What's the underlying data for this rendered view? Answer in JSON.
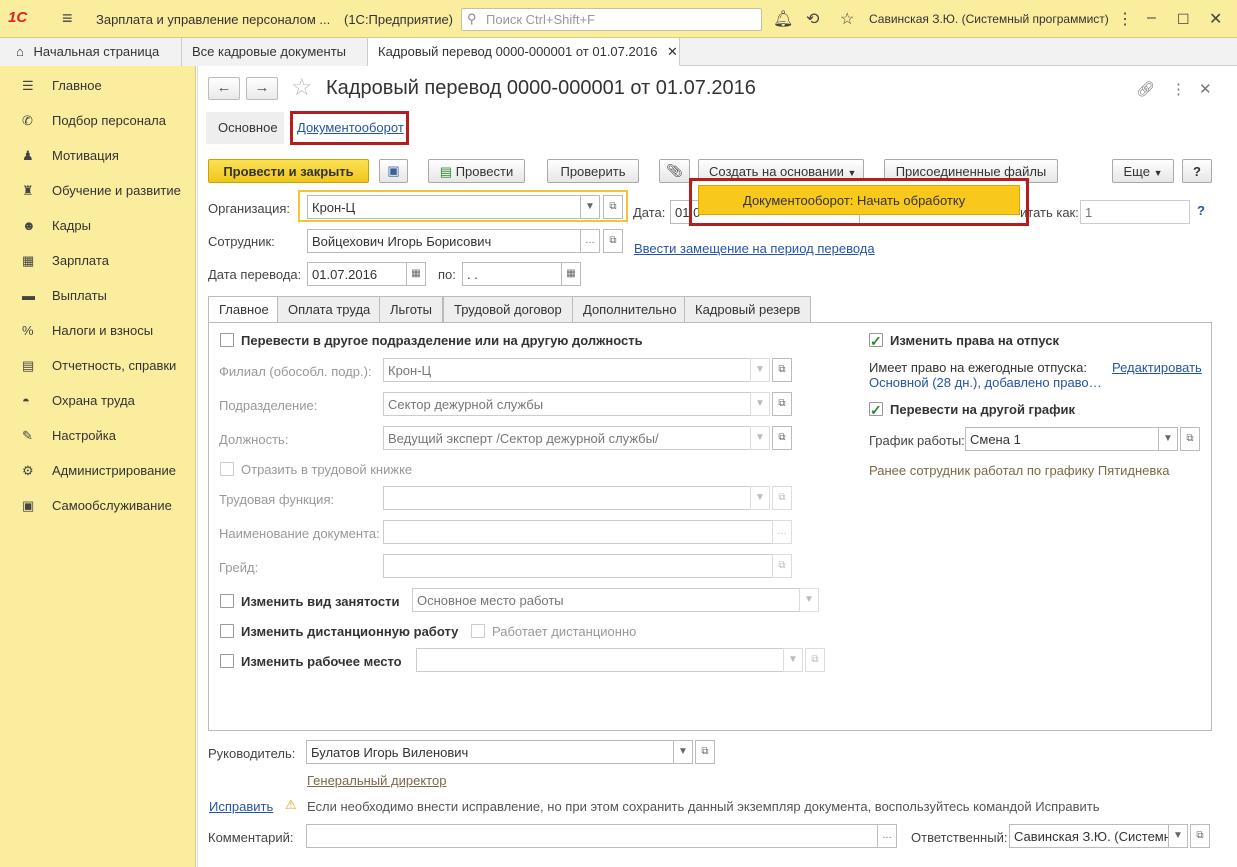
{
  "app": {
    "logo": "1С",
    "title": "Зарплата и управление персоналом ...",
    "mode": "(1С:Предприятие)",
    "search_placeholder": "Поиск Ctrl+Shift+F",
    "user": "Савинская З.Ю. (Системный программист)"
  },
  "tabs": [
    "Начальная страница",
    "Все кадровые документы",
    "Кадровый перевод 0000-000001 от 01.07.2016"
  ],
  "sidebar": {
    "items": [
      {
        "label": "Главное",
        "icon": "menu-icon"
      },
      {
        "label": "Подбор персонала",
        "icon": "phone-icon"
      },
      {
        "label": "Мотивация",
        "icon": "people-icon"
      },
      {
        "label": "Обучение и развитие",
        "icon": "graduation-cap-icon"
      },
      {
        "label": "Кадры",
        "icon": "users-icon"
      },
      {
        "label": "Зарплата",
        "icon": "calculator-icon"
      },
      {
        "label": "Выплаты",
        "icon": "wallet-icon"
      },
      {
        "label": "Налоги и взносы",
        "icon": "percent-icon"
      },
      {
        "label": "Отчетность, справки",
        "icon": "report-icon"
      },
      {
        "label": "Охрана труда",
        "icon": "helmet-icon"
      },
      {
        "label": "Настройка",
        "icon": "wrench-icon"
      },
      {
        "label": "Администрирование",
        "icon": "gear-icon"
      },
      {
        "label": "Самообслуживание",
        "icon": "id-card-icon"
      }
    ]
  },
  "document": {
    "title": "Кадровый перевод 0000-000001 от 01.07.2016",
    "subtabs": [
      "Основное",
      "Документооборот"
    ]
  },
  "toolbar": {
    "post_close": "Провести и закрыть",
    "post": "Провести",
    "check": "Проверить",
    "create_based": "Создать на основании",
    "attached": "Присоединенные файлы",
    "more": "Еще",
    "help": "?"
  },
  "dropdown_menu": {
    "item": "Документооборот: Начать обработку"
  },
  "header_fields": {
    "org_label": "Организация:",
    "org_value": "Крон-Ц",
    "emp_label": "Сотрудник:",
    "emp_value": "Войцехович Игорь Борисович",
    "date_label": "Дата перевода:",
    "date_value": "01.07.2016",
    "to_label": "по:",
    "to_value": " .  .",
    "doc_date_label": "Дата:",
    "doc_date_value": "01.0",
    "number_label": "итать как:",
    "number_value": "1",
    "replace_link": "Ввести замещение на период перевода"
  },
  "form_tabs": [
    "Главное",
    "Оплата труда",
    "Льготы",
    "Трудовой договор",
    "Дополнительно",
    "Кадровый резерв"
  ],
  "main_tab": {
    "transfer_label": "Перевести в другое подразделение или на другую должность",
    "branch_label": "Филиал (обособл. подр.):",
    "branch_value": "Крон-Ц",
    "dept_label": "Подразделение:",
    "dept_value": "Сектор дежурной службы",
    "position_label": "Должность:",
    "position_value": "Ведущий эксперт /Сектор дежурной службы/",
    "workbook_label": "Отразить в трудовой книжке",
    "function_label": "Трудовая функция:",
    "docname_label": "Наименование документа:",
    "grade_label": "Грейд:",
    "employment_label": "Изменить вид занятости",
    "employment_value": "Основное место работы",
    "remote_label": "Изменить дистанционную работу",
    "remote_sub": "Работает дистанционно",
    "workplace_label": "Изменить рабочее место",
    "vacation_label": "Изменить права на отпуск",
    "vacation_right": "Имеет право на ежегодные отпуска:",
    "edit_link": "Редактировать",
    "vacation_value": "Основной (28 дн.), добавлено право…",
    "schedule_check": "Перевести на другой график",
    "schedule_label": "График работы:",
    "schedule_value": "Смена 1",
    "schedule_prev": "Ранее сотрудник работал по графику Пятидневка"
  },
  "footer": {
    "head_label": "Руководитель:",
    "head_value": "Булатов Игорь Виленович",
    "head_position": "Генеральный директор",
    "fix_link": "Исправить",
    "fix_note": "Если необходимо внести исправление, но при этом сохранить данный экземпляр документа, воспользуйтесь командой Исправить",
    "comment_label": "Комментарий:",
    "responsible_label": "Ответственный:",
    "responsible_value": "Савинская З.Ю. (Системный программист)"
  },
  "colors": {
    "accent_yellow": "#fbed9e",
    "primary_button": "#f0c61b",
    "highlight_red": "#b41e1e",
    "link_blue": "#2255aa"
  }
}
